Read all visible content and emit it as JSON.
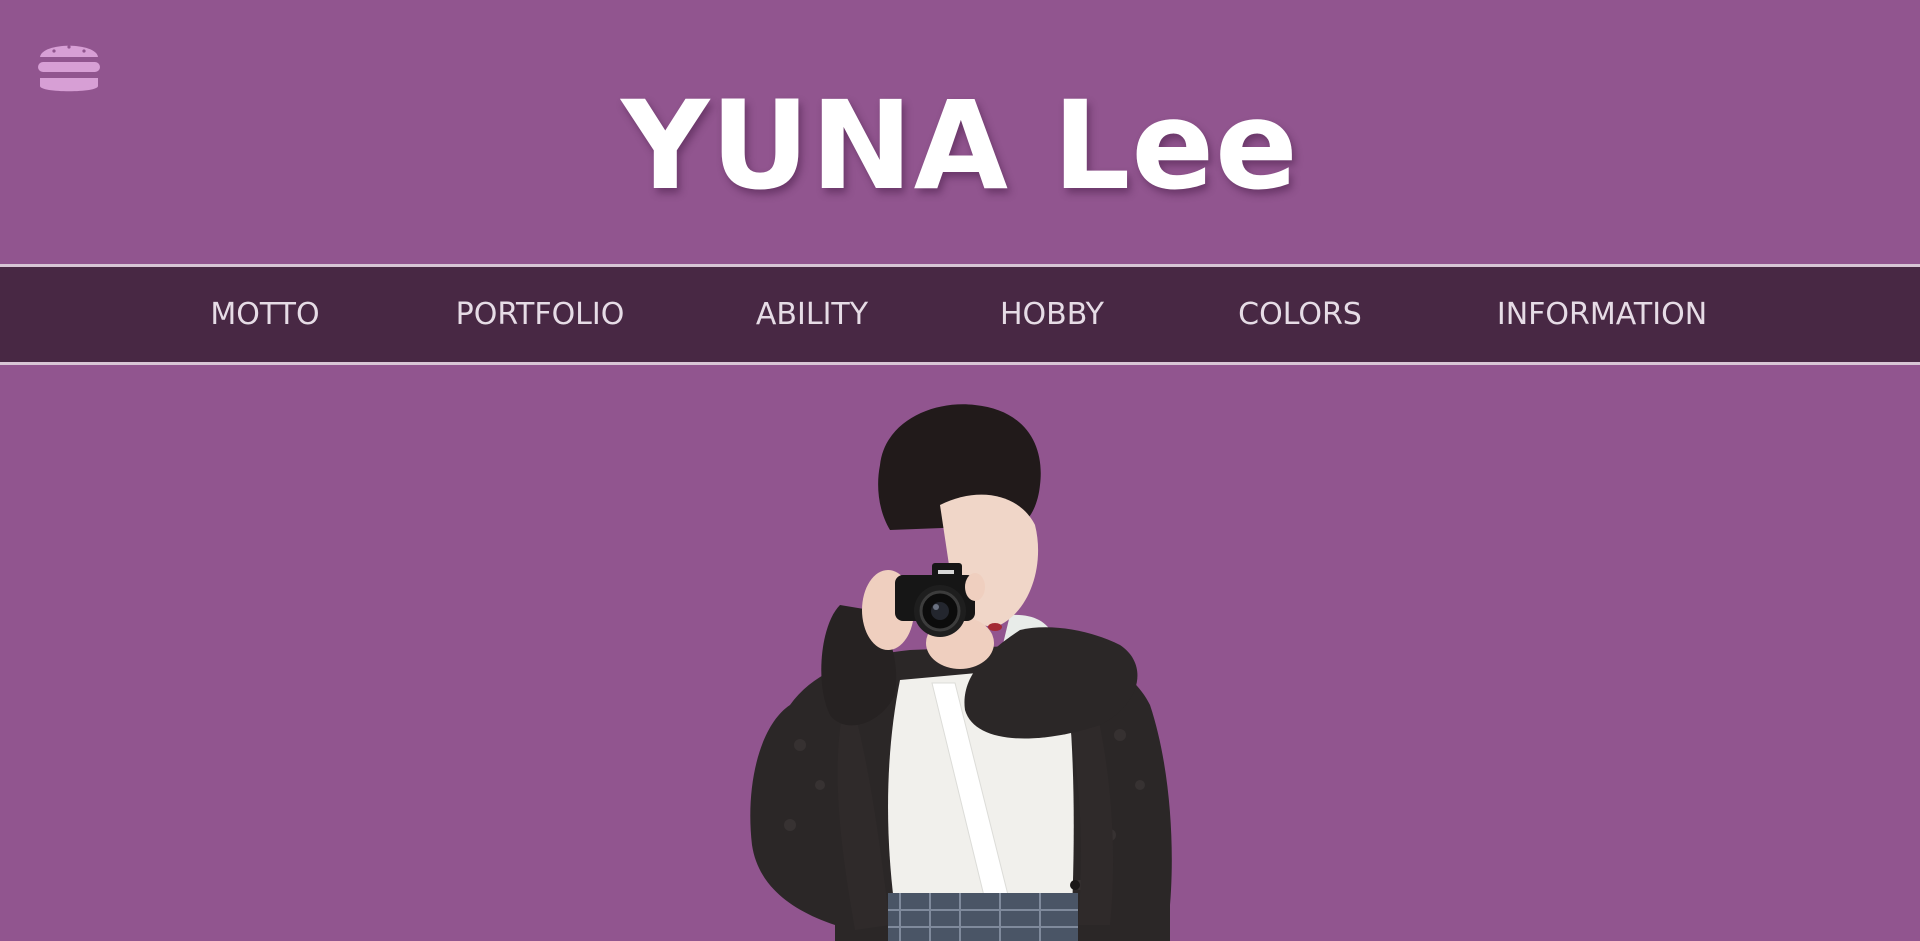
{
  "header": {
    "title": "YUNA Lee",
    "menu_icon": "hamburger-menu-icon"
  },
  "nav": {
    "items": [
      {
        "label": "MOTTO"
      },
      {
        "label": "PORTFOLIO"
      },
      {
        "label": "ABILITY"
      },
      {
        "label": "HOBBY"
      },
      {
        "label": "COLORS"
      },
      {
        "label": "INFORMATION"
      }
    ]
  },
  "hero": {
    "image": "profile-photo-person-holding-camera"
  },
  "colors": {
    "background": "#91558f",
    "nav_background": "#482844",
    "nav_border": "#d8c6d6",
    "nav_text": "#e6dce6",
    "title_text": "#ffffff",
    "menu_icon": "#d79fd5"
  }
}
